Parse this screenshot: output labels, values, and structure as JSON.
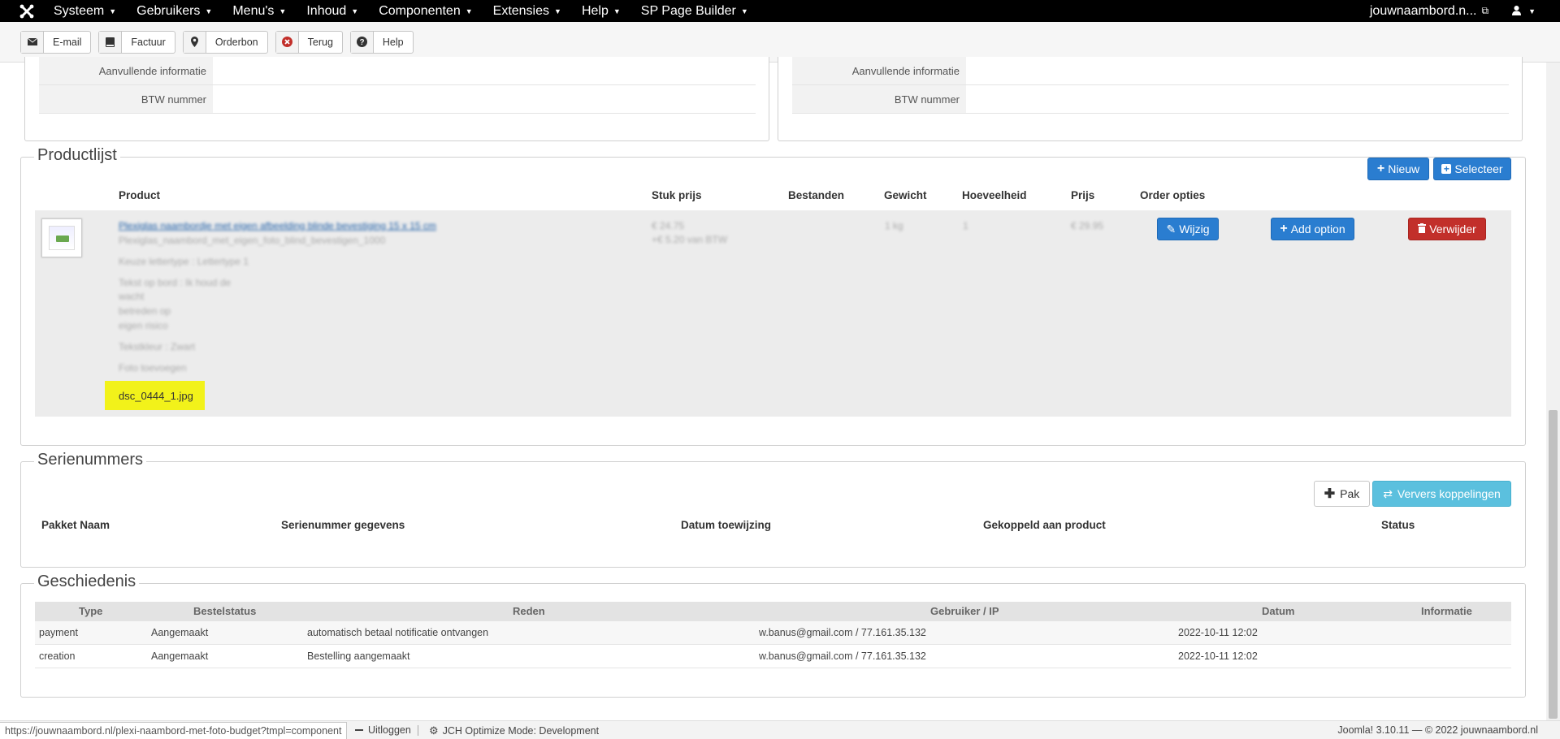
{
  "nav": {
    "menu": [
      "Systeem",
      "Gebruikers",
      "Menu's",
      "Inhoud",
      "Componenten",
      "Extensies",
      "Help",
      "SP Page Builder"
    ],
    "site_link": "jouwnaambord.n...",
    "logo": "joomla-icon"
  },
  "toolbar": {
    "email": "E-mail",
    "factuur": "Factuur",
    "orderbon": "Orderbon",
    "terug": "Terug",
    "help": "Help"
  },
  "address": {
    "left": [
      {
        "label": "Aanvullende informatie"
      },
      {
        "label": "BTW nummer"
      }
    ],
    "right": [
      {
        "label": "Aanvullende informatie"
      },
      {
        "label": "BTW nummer"
      }
    ]
  },
  "products": {
    "title": "Productlijst",
    "new_button": "Nieuw",
    "select_button": "Selecteer",
    "headers": {
      "product": "Product",
      "unit_price": "Stuk prijs",
      "files": "Bestanden",
      "weight": "Gewicht",
      "quantity": "Hoeveelheid",
      "price": "Prijs",
      "options": "Order opties"
    },
    "item": {
      "name_blurred": "Plexiglas naambordje met eigen afbeelding blinde bevestiging 15 x 15 cm",
      "sku_blurred": "Plexiglas_naambord_met_eigen_foto_blind_bevestigen_1000",
      "font_blurred": "Keuze lettertype : Lettertype 1",
      "text_blurred_1": "Tekst op bord : Ik houd de",
      "text_blurred_2": "wacht",
      "text_blurred_3": "betreden op",
      "text_blurred_4": "eigen risico",
      "color_blurred": "Tekstkleur : Zwart",
      "photo_blurred": "Foto toevoegen",
      "file": "dsc_0444_1.jpg",
      "unit_price_blurred": "€ 24.75",
      "vat_blurred": "+€ 5.20 van BTW",
      "weight_blurred": "1 kg",
      "qty_blurred": "1",
      "price_blurred": "€ 29.95",
      "edit_button": "Wijzig",
      "add_option_button": "Add option",
      "delete_button": "Verwijder"
    }
  },
  "serials": {
    "title": "Serienummers",
    "pack_button": "Pak",
    "refresh_button": "Ververs koppelingen",
    "headers": [
      "Pakket Naam",
      "Serienummer gegevens",
      "Datum toewijzing",
      "Gekoppeld aan product",
      "Status"
    ]
  },
  "history": {
    "title": "Geschiedenis",
    "headers": [
      "Type",
      "Bestelstatus",
      "Reden",
      "Gebruiker / IP",
      "Datum",
      "Informatie"
    ],
    "rows": [
      {
        "type": "payment",
        "status": "Aangemaakt",
        "reason": "automatisch betaal notificatie ontvangen",
        "user": "w.banus@gmail.com / 77.161.35.132",
        "date": "2022-10-11 12:02"
      },
      {
        "type": "creation",
        "status": "Aangemaakt",
        "reason": "Bestelling aangemaakt",
        "user": "w.banus@gmail.com / 77.161.35.132",
        "date": "2022-10-11 12:02"
      }
    ]
  },
  "statusbar": {
    "url": "https://jouwnaambord.nl/plexi-naambord-met-foto-budget?tmpl=component",
    "logout": "Uitloggen",
    "jch": "JCH Optimize Mode: Development",
    "version": "Joomla! 3.10.11  —  © 2022 jouwnaambord.nl"
  }
}
